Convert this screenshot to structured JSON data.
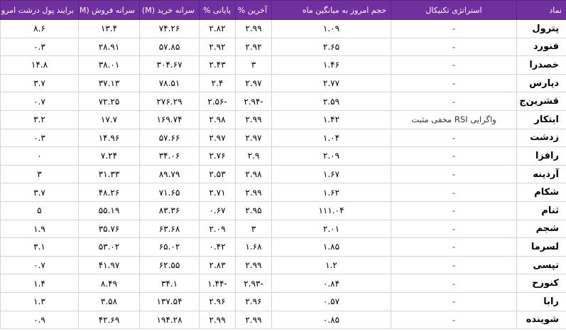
{
  "headers": {
    "symbol": "نماد",
    "technical": "استراتژی تکنیکال",
    "volume_ratio": "حجم امروز به میانگین ماه",
    "last_pct": "آخرین %",
    "close_pct": "پایانی %",
    "buy_per_capita": "سرانه خرید (M)",
    "sell_per_capita": "سرانه فروش (M)",
    "money_flow": "برایند پول درشت امروز (B)"
  },
  "rows": [
    {
      "symbol": "پترول",
      "technical": "-",
      "volume_ratio": "۱.۰۹",
      "last_pct": "۲.۹۹",
      "close_pct": "۲.۸۲",
      "buy": "۷۴.۲۶",
      "sell": "۱۳.۴",
      "flow": "۸.۶"
    },
    {
      "symbol": "فنورد",
      "technical": "-",
      "volume_ratio": "۲.۶۵",
      "last_pct": "۲.۹۲",
      "close_pct": "۲.۹۲",
      "buy": "۵۷.۸۵",
      "sell": "۲۸.۹۱",
      "flow": "۰.۳"
    },
    {
      "symbol": "خصدرا",
      "technical": "-",
      "volume_ratio": "۱.۴۶",
      "last_pct": "۳",
      "close_pct": "۲.۴۳",
      "buy": "۳۰۴.۶۷",
      "sell": "۳۸.۰۱",
      "flow": "۱۴.۸"
    },
    {
      "symbol": "دپارس",
      "technical": "-",
      "volume_ratio": "۲.۷۷",
      "last_pct": "۲.۹۷",
      "close_pct": "۲.۴",
      "buy": "۷۸.۵۱",
      "sell": "۳۷.۱۳",
      "flow": "۳.۷"
    },
    {
      "symbol": "قشرین‌ج",
      "technical": "-",
      "volume_ratio": "۲.۵۹",
      "last_pct": "-۲.۹۴",
      "close_pct": "-۲.۵۶",
      "buy": "۲۷۶.۲۹",
      "sell": "۷۲.۲۵",
      "flow": "۰.۷"
    },
    {
      "symbol": "ابتکار",
      "technical": "واگرایی RSI مخفی مثبت",
      "volume_ratio": "۱.۴۲",
      "last_pct": "۲.۹۹",
      "close_pct": "۲.۹۸",
      "buy": "۱۶۹.۷۴",
      "sell": "۱۷.۷",
      "flow": "۳.۲"
    },
    {
      "symbol": "زدشت",
      "technical": "-",
      "volume_ratio": "۱.۰۴",
      "last_pct": "۲.۹۷",
      "close_pct": "۲.۹۷",
      "buy": "۵۷.۶۶",
      "sell": "۱۴.۹۶",
      "flow": "۰.۳"
    },
    {
      "symbol": "رافزا",
      "technical": "-",
      "volume_ratio": "۲.۰۹",
      "last_pct": "۲.۹",
      "close_pct": "۲.۷۶",
      "buy": "۳۴.۰۶",
      "sell": "۷.۲۴",
      "flow": "۰"
    },
    {
      "symbol": "آردینه",
      "technical": "-",
      "volume_ratio": "۱.۶۷",
      "last_pct": "۲.۹۸",
      "close_pct": "۲.۵۳",
      "buy": "۸۹.۷۹",
      "sell": "۳۱.۳۳",
      "flow": "۳"
    },
    {
      "symbol": "شکام",
      "technical": "-",
      "volume_ratio": "۱.۶۲",
      "last_pct": "۲.۹۹",
      "close_pct": "۲.۷۱",
      "buy": "۷۱.۶۵",
      "sell": "۴۸.۲۶",
      "flow": "۳.۷"
    },
    {
      "symbol": "ثنام",
      "technical": "-",
      "volume_ratio": "۱۱۱.۰۴",
      "last_pct": "۲.۹۵",
      "close_pct": "۰.۶۷",
      "buy": "۸۳.۳۶",
      "sell": "۵۵.۱۹",
      "flow": "۵"
    },
    {
      "symbol": "شجم",
      "technical": "-",
      "volume_ratio": "۲.۰۱",
      "last_pct": "۳",
      "close_pct": "۲.۰۹",
      "buy": "۶۳.۶۸",
      "sell": "۳۵.۷۶",
      "flow": "۱.۹"
    },
    {
      "symbol": "لسرما",
      "technical": "-",
      "volume_ratio": "۱.۸۵",
      "last_pct": "۱.۶۸",
      "close_pct": "۰.۴۲",
      "buy": "۶۵.۰۲",
      "sell": "۵۳.۰۲",
      "flow": "۳.۱"
    },
    {
      "symbol": "تپسی",
      "technical": "-",
      "volume_ratio": "۱.۲",
      "last_pct": "۲.۹۹",
      "close_pct": "۲.۸۳",
      "buy": "۶۲.۵۵",
      "sell": "۴۱.۹۷",
      "flow": "۰.۷"
    },
    {
      "symbol": "کنورح",
      "technical": "-",
      "volume_ratio": "۰.۸۴",
      "last_pct": "-۲.۹۳",
      "close_pct": "-۱.۴۴",
      "buy": "۳۴.۱",
      "sell": "۸.۴۹",
      "flow": "۱.۴"
    },
    {
      "symbol": "رابا",
      "technical": "-",
      "volume_ratio": "۰.۵۷",
      "last_pct": "۲.۹۶",
      "close_pct": "۲.۹۶",
      "buy": "۱۳۷.۵۴",
      "sell": "۳.۵۸",
      "flow": "۱.۳"
    },
    {
      "symbol": "شوینده",
      "technical": "-",
      "volume_ratio": "۰.۸۵",
      "last_pct": "۲.۹۹",
      "close_pct": "۲.۹۹",
      "buy": "۱۹۴.۲۸",
      "sell": "۴۲.۶۹",
      "flow": "۰.۹"
    }
  ]
}
